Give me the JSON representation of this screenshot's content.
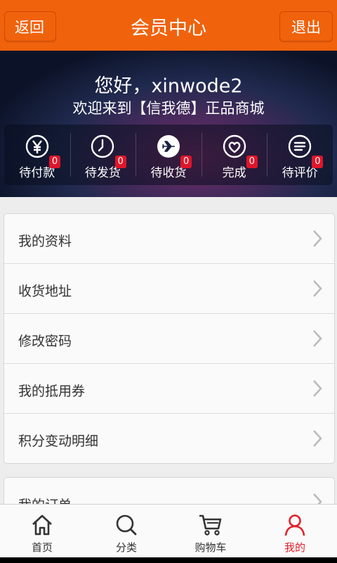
{
  "header": {
    "back_label": "返回",
    "title": "会员中心",
    "logout_label": "退出"
  },
  "profile": {
    "greeting": "您好，xinwode2",
    "welcome": "欢迎来到【信我德】正品商城"
  },
  "order_status": [
    {
      "label": "待付款",
      "count": "0",
      "icon": "yen-icon"
    },
    {
      "label": "待发货",
      "count": "0",
      "icon": "clock-icon"
    },
    {
      "label": "待收货",
      "count": "0",
      "icon": "airplane-icon"
    },
    {
      "label": "完成",
      "count": "0",
      "icon": "heart-icon"
    },
    {
      "label": "待评价",
      "count": "0",
      "icon": "comment-icon"
    }
  ],
  "menu": [
    {
      "label": "我的资料"
    },
    {
      "label": "收货地址"
    },
    {
      "label": "修改密码"
    },
    {
      "label": "我的抵用券"
    },
    {
      "label": "积分变动明细"
    }
  ],
  "menu2": [
    {
      "label": "我的订单"
    }
  ],
  "tabs": [
    {
      "label": "首页",
      "icon": "home-icon"
    },
    {
      "label": "分类",
      "icon": "search-icon"
    },
    {
      "label": "购物车",
      "icon": "cart-icon"
    },
    {
      "label": "我的",
      "icon": "user-icon",
      "active": true
    }
  ],
  "colors": {
    "accent": "#f0620c",
    "badge": "#e0152a",
    "active_tab": "#e0202a"
  }
}
